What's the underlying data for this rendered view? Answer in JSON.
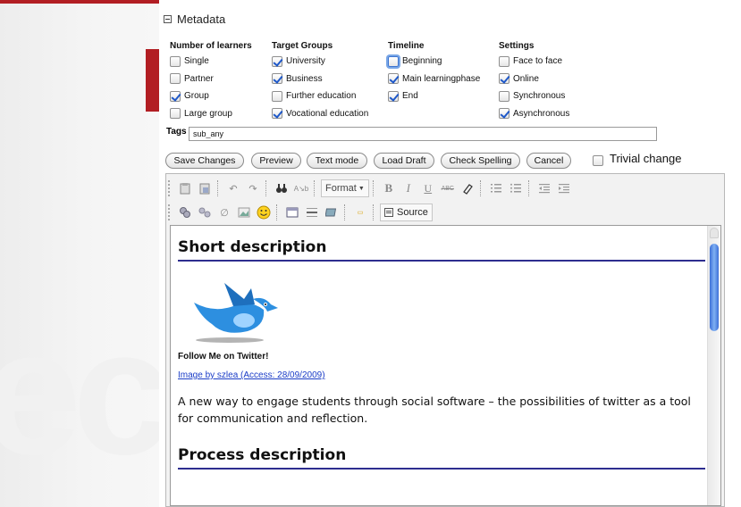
{
  "metadata": {
    "title": "Metadata",
    "columns": [
      {
        "title": "Number of learners",
        "items": [
          {
            "label": "Single",
            "checked": false
          },
          {
            "label": "Partner",
            "checked": false
          },
          {
            "label": "Group",
            "checked": true
          },
          {
            "label": "Large group",
            "checked": false
          }
        ]
      },
      {
        "title": "Target Groups",
        "items": [
          {
            "label": "University",
            "checked": true
          },
          {
            "label": "Business",
            "checked": true
          },
          {
            "label": "Further education",
            "checked": false
          },
          {
            "label": "Vocational education",
            "checked": true
          }
        ]
      },
      {
        "title": "Timeline",
        "items": [
          {
            "label": "Beginning",
            "checked": false
          },
          {
            "label": "Main learningphase",
            "checked": true
          },
          {
            "label": "End",
            "checked": true
          }
        ]
      },
      {
        "title": "Settings",
        "items": [
          {
            "label": "Face to face",
            "checked": false
          },
          {
            "label": "Online",
            "checked": true
          },
          {
            "label": "Synchronous",
            "checked": false
          },
          {
            "label": "Asynchronous",
            "checked": true
          }
        ]
      }
    ]
  },
  "tags": {
    "label": "Tags",
    "value": "sub_any"
  },
  "buttons": {
    "save": "Save Changes",
    "preview": "Preview",
    "text_mode": "Text mode",
    "load_draft": "Load Draft",
    "check_spelling": "Check Spelling",
    "cancel": "Cancel"
  },
  "trivial_change": {
    "label": "Trivial change",
    "checked": false
  },
  "toolbar": {
    "format_label": "Format",
    "source_label": "Source"
  },
  "document": {
    "heading1": "Short description",
    "image_caption": "Follow Me on Twitter!",
    "image_link": "Image by szlea (Access: 28/09/2009)",
    "paragraph": "A new way to engage students through social software – the possibilities of twitter as a tool for communication and reflection.",
    "heading2": "Process description"
  },
  "colors": {
    "accent_red": "#b21e23",
    "link_blue": "#1a3cc7",
    "heading_rule": "#2d2d8f",
    "bird_blue": "#2d8fe0"
  }
}
